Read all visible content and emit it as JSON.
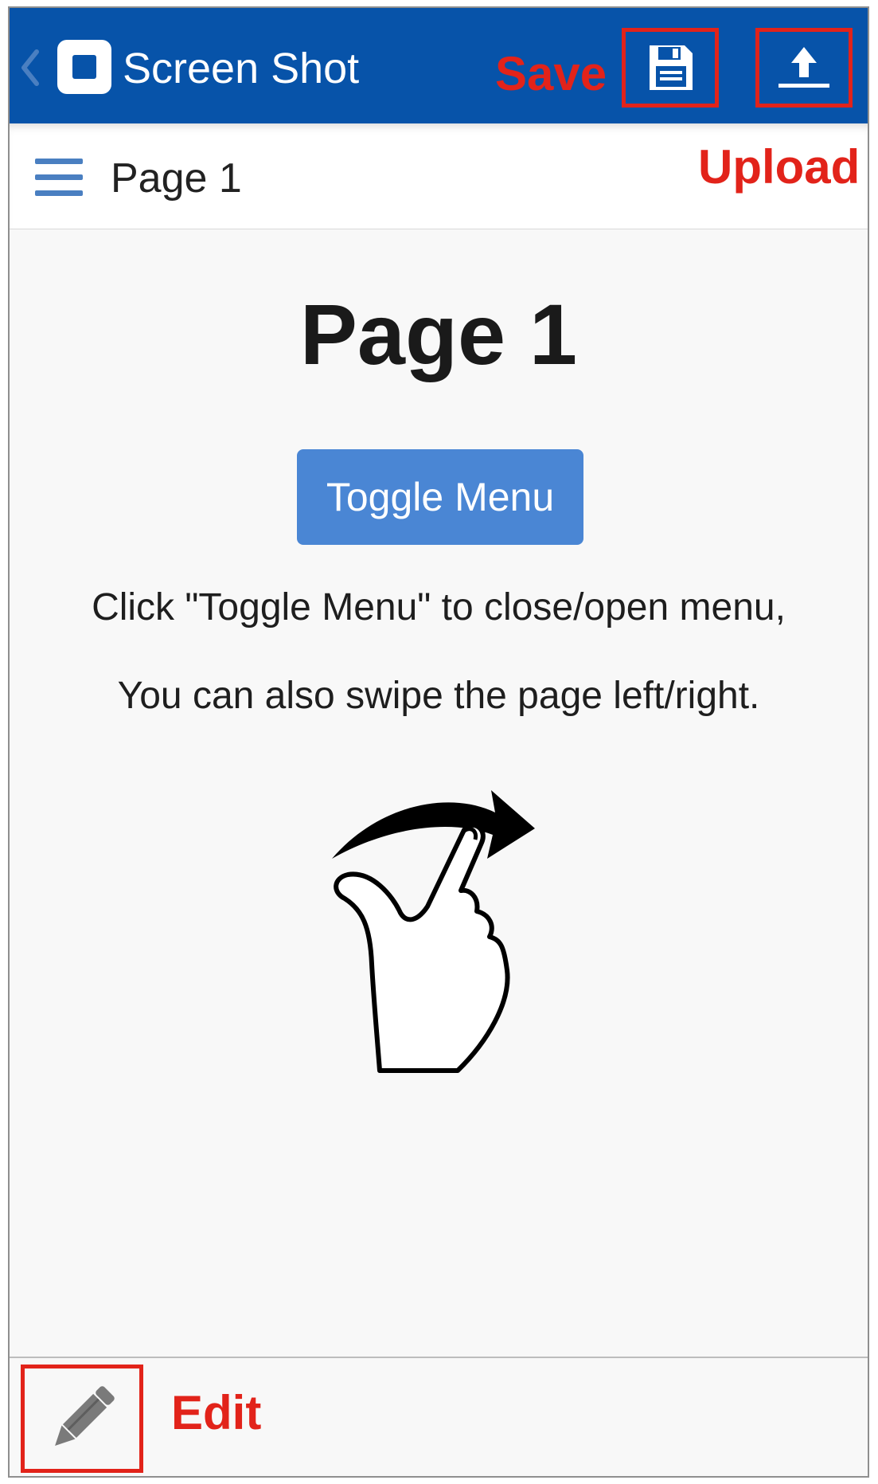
{
  "titlebar": {
    "back_icon": "chevron-left-icon",
    "app_icon": "square-app-icon",
    "title": "Screen Shot",
    "background": "#0753a9"
  },
  "annotations": {
    "save": "Save",
    "upload": "Upload",
    "edit": "Edit",
    "color": "#e2231a"
  },
  "actions": {
    "save_icon": "floppy-disk-icon",
    "upload_icon": "upload-arrow-icon",
    "edit_icon": "pencil-icon"
  },
  "subheader": {
    "menu_icon": "hamburger-menu-icon",
    "title": "Page 1"
  },
  "content": {
    "heading": "Page 1",
    "toggle_button": "Toggle Menu",
    "instruction_1": "Click \"Toggle Menu\" to close/open menu,",
    "instruction_2": "You can also swipe the page left/right.",
    "illustration": "swipe-gesture-icon",
    "button_color": "#4a86d4"
  }
}
